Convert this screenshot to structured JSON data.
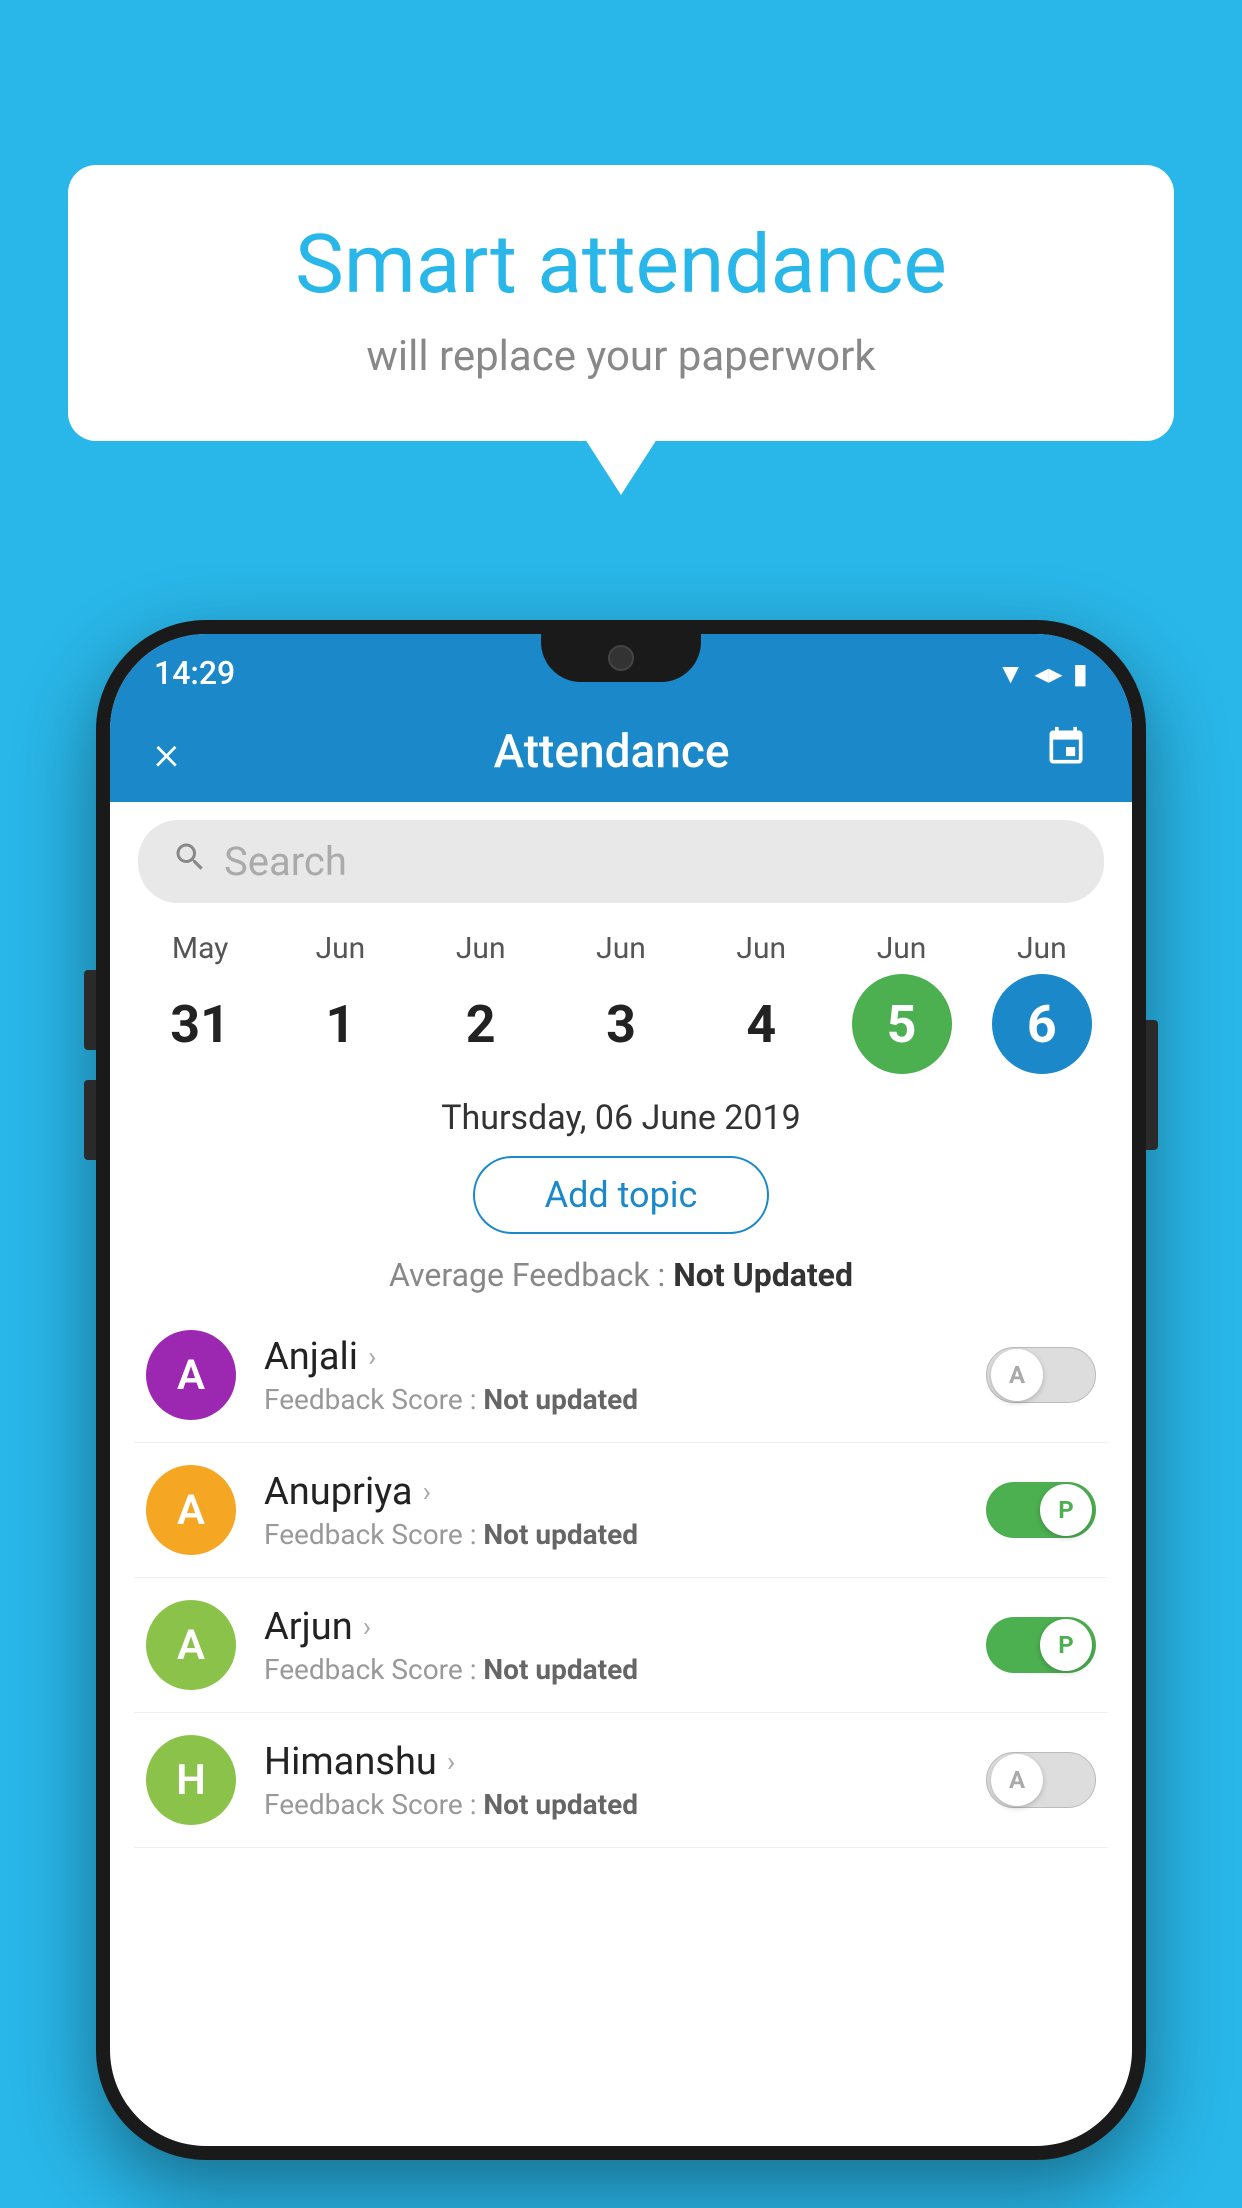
{
  "background_color": "#29b6e8",
  "speech_bubble": {
    "title": "Smart attendance",
    "subtitle": "will replace your paperwork"
  },
  "phone": {
    "status_bar": {
      "time": "14:29",
      "wifi": "▼",
      "signal": "▲",
      "battery": "▮"
    },
    "header": {
      "title": "Attendance",
      "close_label": "×",
      "calendar_icon": "📅"
    },
    "search": {
      "placeholder": "Search"
    },
    "calendar": {
      "days": [
        {
          "month": "May",
          "date": "31",
          "state": "normal"
        },
        {
          "month": "Jun",
          "date": "1",
          "state": "normal"
        },
        {
          "month": "Jun",
          "date": "2",
          "state": "normal"
        },
        {
          "month": "Jun",
          "date": "3",
          "state": "normal"
        },
        {
          "month": "Jun",
          "date": "4",
          "state": "normal"
        },
        {
          "month": "Jun",
          "date": "5",
          "state": "today"
        },
        {
          "month": "Jun",
          "date": "6",
          "state": "selected"
        }
      ]
    },
    "selected_date": "Thursday, 06 June 2019",
    "add_topic_label": "Add topic",
    "average_feedback_label": "Average Feedback :",
    "average_feedback_value": "Not Updated",
    "students": [
      {
        "name": "Anjali",
        "avatar_letter": "A",
        "avatar_color": "#9c27b0",
        "feedback_label": "Feedback Score :",
        "feedback_value": "Not updated",
        "toggle_state": "off",
        "toggle_label": "A"
      },
      {
        "name": "Anupriya",
        "avatar_letter": "A",
        "avatar_color": "#f5a623",
        "feedback_label": "Feedback Score :",
        "feedback_value": "Not updated",
        "toggle_state": "on",
        "toggle_label": "P"
      },
      {
        "name": "Arjun",
        "avatar_letter": "A",
        "avatar_color": "#8bc34a",
        "feedback_label": "Feedback Score :",
        "feedback_value": "Not updated",
        "toggle_state": "on",
        "toggle_label": "P"
      },
      {
        "name": "Himanshu",
        "avatar_letter": "H",
        "avatar_color": "#8bc34a",
        "feedback_label": "Feedback Score :",
        "feedback_value": "Not updated",
        "toggle_state": "off",
        "toggle_label": "A"
      }
    ]
  }
}
